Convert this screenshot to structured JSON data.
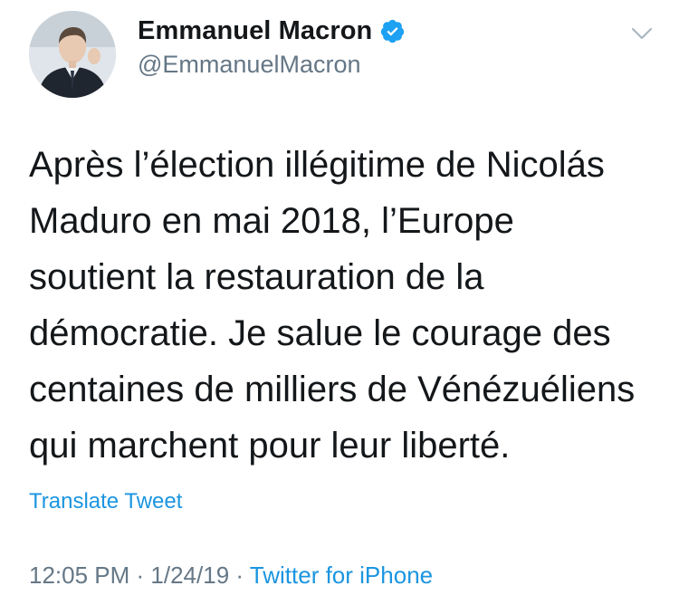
{
  "user": {
    "display_name": "Emmanuel Macron",
    "handle": "@EmmanuelMacron",
    "verified": true
  },
  "icons": {
    "verified": "verified-badge-icon",
    "menu": "chevron-down-icon",
    "avatar": "profile-photo"
  },
  "tweet": {
    "lines": [
      "Après l’élection illégitime de Nicolás",
      "Maduro en mai 2018, l’Europe",
      "soutient la restauration de la",
      "démocratie. Je salue le courage des",
      "centaines de milliers de Vénézuéliens",
      "qui marchent pour leur liberté."
    ],
    "translate_label": "Translate Tweet"
  },
  "meta": {
    "time": "12:05 PM",
    "separator1": " · ",
    "date": "1/24/19",
    "separator2": " · ",
    "source": "Twitter for iPhone"
  },
  "colors": {
    "link": "#1b95e0",
    "secondary_text": "#657786",
    "primary_text": "#14171a",
    "verified": "#1da1f2"
  }
}
